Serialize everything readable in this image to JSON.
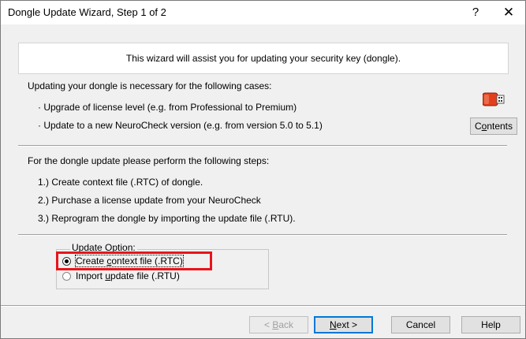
{
  "window": {
    "title": "Dongle Update Wizard, Step 1 of 2",
    "help_glyph": "?",
    "close_glyph": "✕"
  },
  "banner": {
    "text": "This wizard will assist you for updating your security key (dongle)."
  },
  "cases": {
    "heading": "Updating your dongle is necessary for the following cases:",
    "items": [
      "· Upgrade of license level (e.g. from Professional to Premium)",
      "· Update to a new NeuroCheck version (e.g. from version 5.0 to 5.1)"
    ],
    "contents_button": {
      "pre": "C",
      "accel": "o",
      "post": "ntents"
    },
    "icon": "usb-dongle-icon",
    "icon_color": "#e2401c"
  },
  "steps": {
    "heading": "For the dongle update please perform the following steps:",
    "items": [
      "1.) Create context file (.RTC) of dongle.",
      "2.) Purchase a license update from your NeuroCheck",
      "3.) Reprogram the dongle by importing the update file (.RTU)."
    ]
  },
  "update_option": {
    "label": "Update Option:",
    "options": [
      {
        "pre": "Create ",
        "accel": "c",
        "post": "ontext file (.RTC)",
        "selected": true
      },
      {
        "pre": "Import ",
        "accel": "u",
        "post": "pdate file (.RTU)",
        "selected": false
      }
    ],
    "highlight_color": "#e8141a"
  },
  "buttons": {
    "back": {
      "pre": "< ",
      "accel": "B",
      "post": "ack",
      "enabled": false
    },
    "next": {
      "pre": "",
      "accel": "N",
      "post": "ext >",
      "default": true
    },
    "cancel": "Cancel",
    "help": "Help"
  }
}
